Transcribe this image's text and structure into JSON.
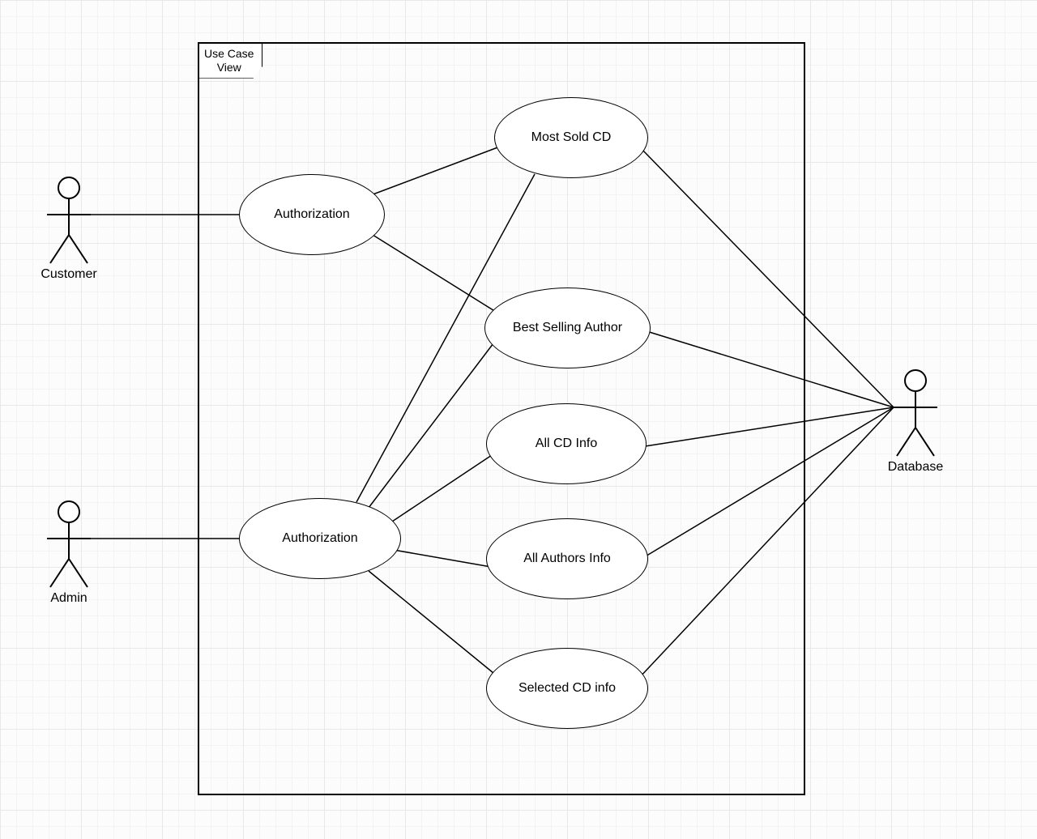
{
  "frame": {
    "line1": "Use Case",
    "line2": "View"
  },
  "actors": {
    "customer": "Customer",
    "admin": "Admin",
    "database": "Database"
  },
  "usecases": {
    "auth_customer": "Authorization",
    "auth_admin": "Authorization",
    "most_sold_cd": "Most Sold CD",
    "best_selling_author": "Best Selling Author",
    "all_cd_info": "All CD Info",
    "all_authors_info": "All Authors Info",
    "selected_cd_info": "Selected CD info"
  },
  "diagram": {
    "type": "uml-use-case",
    "actors": [
      {
        "id": "customer",
        "label": "Customer",
        "side": "left"
      },
      {
        "id": "admin",
        "label": "Admin",
        "side": "left"
      },
      {
        "id": "database",
        "label": "Database",
        "side": "right"
      }
    ],
    "use_cases": [
      {
        "id": "auth_customer",
        "label": "Authorization"
      },
      {
        "id": "auth_admin",
        "label": "Authorization"
      },
      {
        "id": "most_sold_cd",
        "label": "Most Sold CD"
      },
      {
        "id": "best_selling_author",
        "label": "Best Selling Author"
      },
      {
        "id": "all_cd_info",
        "label": "All CD Info"
      },
      {
        "id": "all_authors_info",
        "label": "All Authors Info"
      },
      {
        "id": "selected_cd_info",
        "label": "Selected CD info"
      }
    ],
    "associations": [
      [
        "customer",
        "auth_customer"
      ],
      [
        "admin",
        "auth_admin"
      ],
      [
        "auth_customer",
        "most_sold_cd"
      ],
      [
        "auth_customer",
        "best_selling_author"
      ],
      [
        "auth_admin",
        "most_sold_cd"
      ],
      [
        "auth_admin",
        "best_selling_author"
      ],
      [
        "auth_admin",
        "all_cd_info"
      ],
      [
        "auth_admin",
        "all_authors_info"
      ],
      [
        "auth_admin",
        "selected_cd_info"
      ],
      [
        "most_sold_cd",
        "database"
      ],
      [
        "best_selling_author",
        "database"
      ],
      [
        "all_cd_info",
        "database"
      ],
      [
        "all_authors_info",
        "database"
      ],
      [
        "selected_cd_info",
        "database"
      ]
    ]
  }
}
